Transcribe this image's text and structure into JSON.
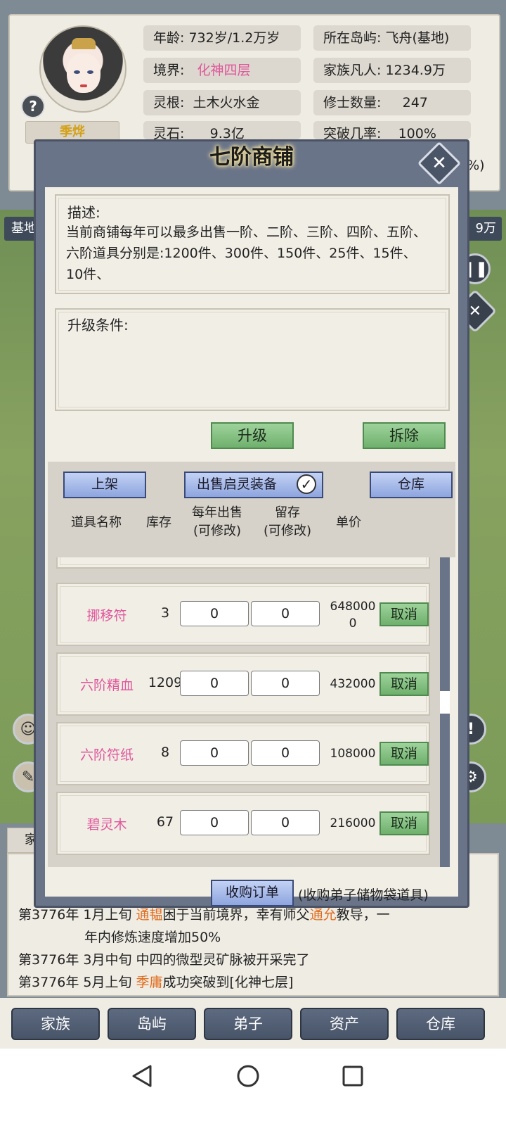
{
  "top_panel": {
    "character_name": "季烨",
    "stats": {
      "age_label": "年龄:",
      "age_value": "732岁/1.2万岁",
      "realm_label": "境界:",
      "realm_value": "化神四层",
      "root_label": "灵根:",
      "root_value": "土木火水金",
      "stone_label": "灵石:",
      "stone_value": "9.3亿",
      "island_label": "所在岛屿:",
      "island_value": "飞舟(基地)",
      "mortals_label": "家族凡人:",
      "mortals_value": "1234.9万",
      "cultivators_label": "修士数量:",
      "cultivators_value": "247",
      "breakthrough_label": "突破几率:",
      "breakthrough_value": "100%"
    },
    "help_icon_text": "?",
    "partial_right_text": "1%)"
  },
  "map": {
    "left_tab": "基地",
    "right_tab": "9万",
    "pause_icon": "pause-icon",
    "close_icon": "close-icon"
  },
  "modal": {
    "title": "七阶商铺",
    "close_icon": "close-icon",
    "description_title": "描述:",
    "description_text": "当前商铺每年可以最多出售一阶、二阶、三阶、四阶、五阶、六阶道具分别是:1200件、300件、150件、25件、15件、10件、",
    "upgrade_title": "升级条件:",
    "upgrade_button": "升级",
    "demolish_button": "拆除",
    "shelf_button": "上架",
    "sell_toggle_label": "出售启灵装备",
    "warehouse_button": "仓库",
    "columns": {
      "name": "道具名称",
      "stock": "库存",
      "yearly_sale_line1": "每年出售",
      "yearly_sale_line2": "(可修改)",
      "reserve_line1": "留存",
      "reserve_line2": "(可修改)",
      "price": "单价"
    },
    "items": [
      {
        "name": "挪移符",
        "stock": "3",
        "yearly_sale": "0",
        "reserve": "0",
        "price_line1": "648000",
        "price_line2": "0",
        "action": "取消"
      },
      {
        "name": "六阶精血",
        "stock": "1209",
        "yearly_sale": "0",
        "reserve": "0",
        "price_line1": "432000",
        "price_line2": "",
        "action": "取消"
      },
      {
        "name": "六阶符纸",
        "stock": "8",
        "yearly_sale": "0",
        "reserve": "0",
        "price_line1": "108000",
        "price_line2": "",
        "action": "取消"
      },
      {
        "name": "碧灵木",
        "stock": "67",
        "yearly_sale": "0",
        "reserve": "0",
        "price_line1": "216000",
        "price_line2": "",
        "action": "取消"
      }
    ],
    "partial_top_row": {
      "action": "取消"
    },
    "purchase_button": "收购订单",
    "purchase_note": "(收购弟子储物袋道具)"
  },
  "log": {
    "tab_label": "家",
    "lines": [
      {
        "prefix": "第3776年 1月上旬 ",
        "name1": "通韫",
        "mid": "困于当前境界，幸有师父",
        "name2": "通允",
        "suffix": "教导，一"
      },
      {
        "text": "年内修炼速度增加50%"
      },
      {
        "text": "第3776年 3月中旬 中四的微型灵矿脉被开采完了"
      },
      {
        "prefix": "第3776年 5月上旬 ",
        "name1": "季庸",
        "suffix": "成功突破到[化神七层]"
      }
    ]
  },
  "bottom_nav": [
    "家族",
    "岛屿",
    "弟子",
    "资产",
    "仓库"
  ],
  "colors": {
    "pink_text": "#e0579b",
    "orange_text": "#e06b1c",
    "gold_name": "#d4a017",
    "green_button": "#6fb06d",
    "blue_button": "#8ea5de",
    "modal_frame": "#6a7488"
  }
}
